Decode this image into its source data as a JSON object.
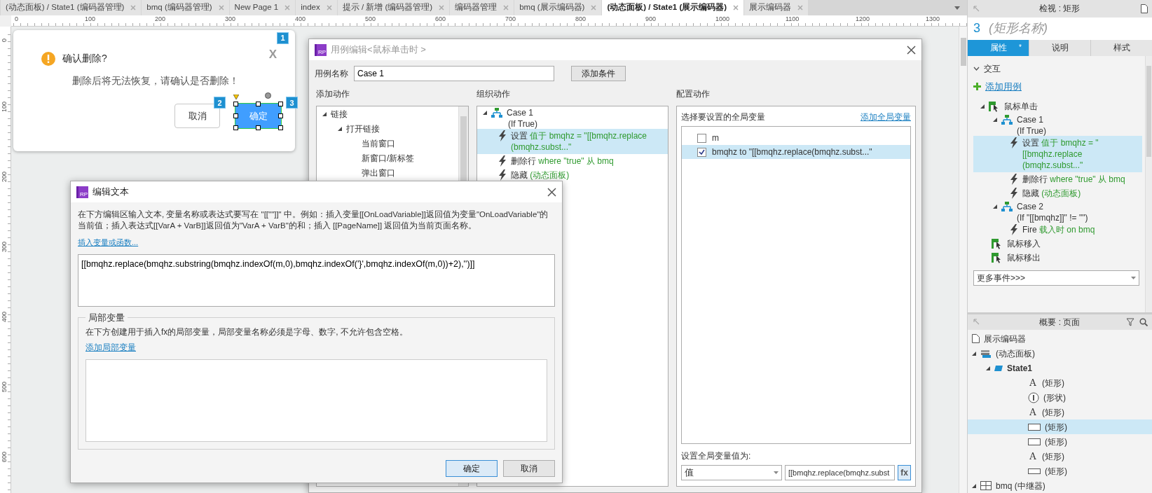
{
  "doc_tabs": [
    {
      "label": "(动态面板) / State1 (编码器管理)",
      "selected": false
    },
    {
      "label": "bmq (编码器管理)",
      "selected": false
    },
    {
      "label": "New Page 1",
      "selected": false
    },
    {
      "label": "index",
      "selected": false
    },
    {
      "label": "提示 / 新增 (编码器管理)",
      "selected": false
    },
    {
      "label": "编码器管理",
      "selected": false
    },
    {
      "label": "bmq (展示编码器)",
      "selected": false
    },
    {
      "label": "(动态面板) / State1 (展示编码器)",
      "selected": true
    },
    {
      "label": "展示编码器",
      "selected": false
    }
  ],
  "ruler": {
    "h_labels": [
      "0",
      "100",
      "200",
      "300",
      "400",
      "500",
      "600",
      "700",
      "800",
      "900",
      "1000",
      "1100",
      "1200",
      "1300"
    ],
    "v_labels": [
      "0",
      "100",
      "200",
      "300",
      "400",
      "500",
      "600"
    ]
  },
  "mock_dialog": {
    "close": {
      "glyph": "X",
      "marker": "1"
    },
    "title": "确认删除?",
    "message": "删除后将无法恢复，请确认是否删除！",
    "buttons": [
      {
        "label": "取消",
        "kind": "secondary",
        "marker": "2",
        "selected": false
      },
      {
        "label": "确定",
        "kind": "primary",
        "marker": "3",
        "selected": true
      }
    ]
  },
  "case_editor": {
    "logo": "RP",
    "title": "用例编辑<鼠标单击时 >",
    "name_label": "用例名称",
    "name_value": "Case 1",
    "add_condition": "添加条件",
    "add_actions": {
      "heading": "添加动作",
      "tree": [
        {
          "label": "链接",
          "expanded": true,
          "children": [
            {
              "label": "打开链接",
              "expanded": true,
              "children": [
                {
                  "label": "当前窗口"
                },
                {
                  "label": "新窗口/新标签"
                },
                {
                  "label": "弹出窗口"
                }
              ]
            }
          ]
        }
      ]
    },
    "organize": {
      "heading": "组织动作",
      "cases": [
        {
          "label": "Case 1",
          "condition": "(If True)",
          "expanded": true,
          "actions": [
            {
              "verb": "设置",
              "detail": "值于 bmqhz = \"[[bmqhz.replace (bmqhz.subst...\"",
              "selected": true
            },
            {
              "verb": "删除行",
              "detail": "where \"true\" 从 bmq",
              "selected": false
            },
            {
              "verb": "隐藏",
              "detail": "(动态面板)",
              "selected": false
            }
          ]
        }
      ]
    },
    "configure": {
      "heading": "配置动作",
      "prompt": "选择要设置的全局变量",
      "add_link": "添加全局变量",
      "variables": [
        {
          "label": "m",
          "checked": false,
          "selected": false
        },
        {
          "label": "bmqhz to \"[[bmqhz.replace(bmqhz.subst...\"",
          "checked": true,
          "selected": true
        }
      ],
      "set_label": "设置全局变量值为:",
      "value_type": "值",
      "value": "[[bmqhz.replace(bmqhz.subst",
      "fx": "fx"
    }
  },
  "edit_text": {
    "logo": "RP",
    "title": "编辑文本",
    "instructions": "在下方编辑区输入文本, 变量名称或表达式要写在 \"[[\"\"]]\" 中。例如：插入变量[[OnLoadVariable]]返回值为变量\"OnLoadVariable\"的当前值；插入表达式[[VarA + VarB]]返回值为\"VarA + VarB\"的和；插入 [[PageName]] 返回值为当前页面名称。",
    "insert_link": "插入变量或函数...",
    "expression": "[[bmqhz.replace(bmqhz.substring(bmqhz.indexOf(m,0),bmqhz.indexOf('}',bmqhz.indexOf(m,0))+2),'')]]",
    "local_vars": {
      "legend": "局部变量",
      "description": "在下方创建用于插入fx的局部变量，局部变量名称必须是字母、数字, 不允许包含空格。",
      "add_link": "添加局部变量"
    },
    "buttons": [
      {
        "label": "确定",
        "kind": "primary"
      },
      {
        "label": "取消",
        "kind": "secondary"
      }
    ]
  },
  "inspector": {
    "header": "检视 : 矩形",
    "widget_number": "3",
    "name_field": {
      "placeholder": "(矩形名称)"
    },
    "tabs": [
      {
        "label": "属性",
        "badge": "*",
        "selected": true
      },
      {
        "label": "说明",
        "selected": false
      },
      {
        "label": "样式",
        "selected": false
      }
    ],
    "section": {
      "label": "交互",
      "expanded": true
    },
    "add_case": "添加用例",
    "events": [
      {
        "label": "鼠标单击",
        "expanded": true,
        "cases": [
          {
            "label": "Case 1",
            "condition": "(If True)",
            "expanded": true,
            "actions": [
              {
                "verb": "设置",
                "detail": "值于 bmqhz = \"[[bmqhz.replace (bmqhz.subst...\"",
                "selected": true
              },
              {
                "verb": "删除行",
                "detail": "where \"true\" 从 bmq",
                "selected": false
              },
              {
                "verb": "隐藏",
                "detail": "(动态面板)",
                "selected": false
              }
            ]
          },
          {
            "label": "Case 2",
            "condition": "(If \"[[bmqhz]]\" != \"\")",
            "expanded": true,
            "actions": [
              {
                "verb": "Fire",
                "detail": "载入时  on bmq",
                "selected": false
              }
            ]
          }
        ]
      },
      {
        "label": "鼠标移入"
      },
      {
        "label": "鼠标移出"
      }
    ],
    "more_events": "更多事件>>>"
  },
  "outline": {
    "header": "概要 : 页面",
    "tree": [
      {
        "label": "展示编码器",
        "kind": "page",
        "selected": false
      },
      {
        "label": "(动态面板)",
        "kind": "panel",
        "expanded": true,
        "selected": false,
        "children": [
          {
            "label": "State1",
            "kind": "state",
            "expanded": true,
            "selected": false,
            "children": [
              {
                "label": "(矩形)",
                "kind": "text",
                "glyph": "A",
                "selected": false
              },
              {
                "label": "(形状)",
                "kind": "info",
                "selected": false
              },
              {
                "label": "(矩形)",
                "kind": "text",
                "glyph": "A",
                "selected": false
              },
              {
                "label": "(矩形)",
                "kind": "rect",
                "selected": true
              },
              {
                "label": "(矩形)",
                "kind": "rect",
                "selected": false
              },
              {
                "label": "(矩形)",
                "kind": "text",
                "glyph": "A",
                "selected": false
              },
              {
                "label": "(矩形)",
                "kind": "line",
                "selected": false
              }
            ]
          }
        ]
      },
      {
        "label": "bmq (中继器)",
        "kind": "repeater",
        "expanded": true,
        "selected": false
      }
    ]
  }
}
